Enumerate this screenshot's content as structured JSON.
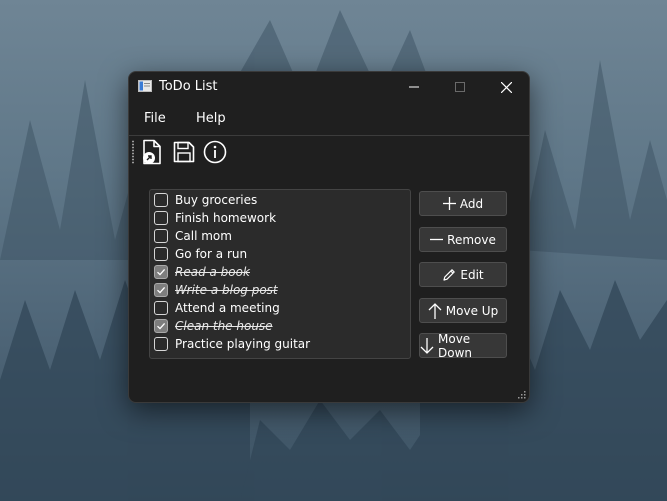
{
  "window": {
    "title": "ToDo List"
  },
  "menubar": {
    "items": [
      {
        "label": "File"
      },
      {
        "label": "Help"
      }
    ]
  },
  "toolbar": {
    "tools": [
      {
        "icon": "open-file-icon"
      },
      {
        "icon": "save-icon"
      },
      {
        "icon": "info-icon"
      }
    ]
  },
  "todo_list": {
    "items": [
      {
        "label": "Buy groceries",
        "checked": false
      },
      {
        "label": "Finish homework",
        "checked": false
      },
      {
        "label": "Call mom",
        "checked": false
      },
      {
        "label": "Go for a run",
        "checked": false
      },
      {
        "label": "Read a book",
        "checked": true
      },
      {
        "label": "Write a blog post",
        "checked": true
      },
      {
        "label": "Attend a meeting",
        "checked": false
      },
      {
        "label": "Clean the house",
        "checked": true
      },
      {
        "label": "Practice playing guitar",
        "checked": false
      }
    ]
  },
  "buttons": {
    "add": "Add",
    "remove": "Remove",
    "edit": "Edit",
    "move_up": "Move Up",
    "move_down": "Move Down"
  },
  "colors": {
    "window_bg": "#1f1f1f",
    "list_bg": "#2b2b2b",
    "button_bg": "#373737",
    "text": "#ffffff"
  }
}
